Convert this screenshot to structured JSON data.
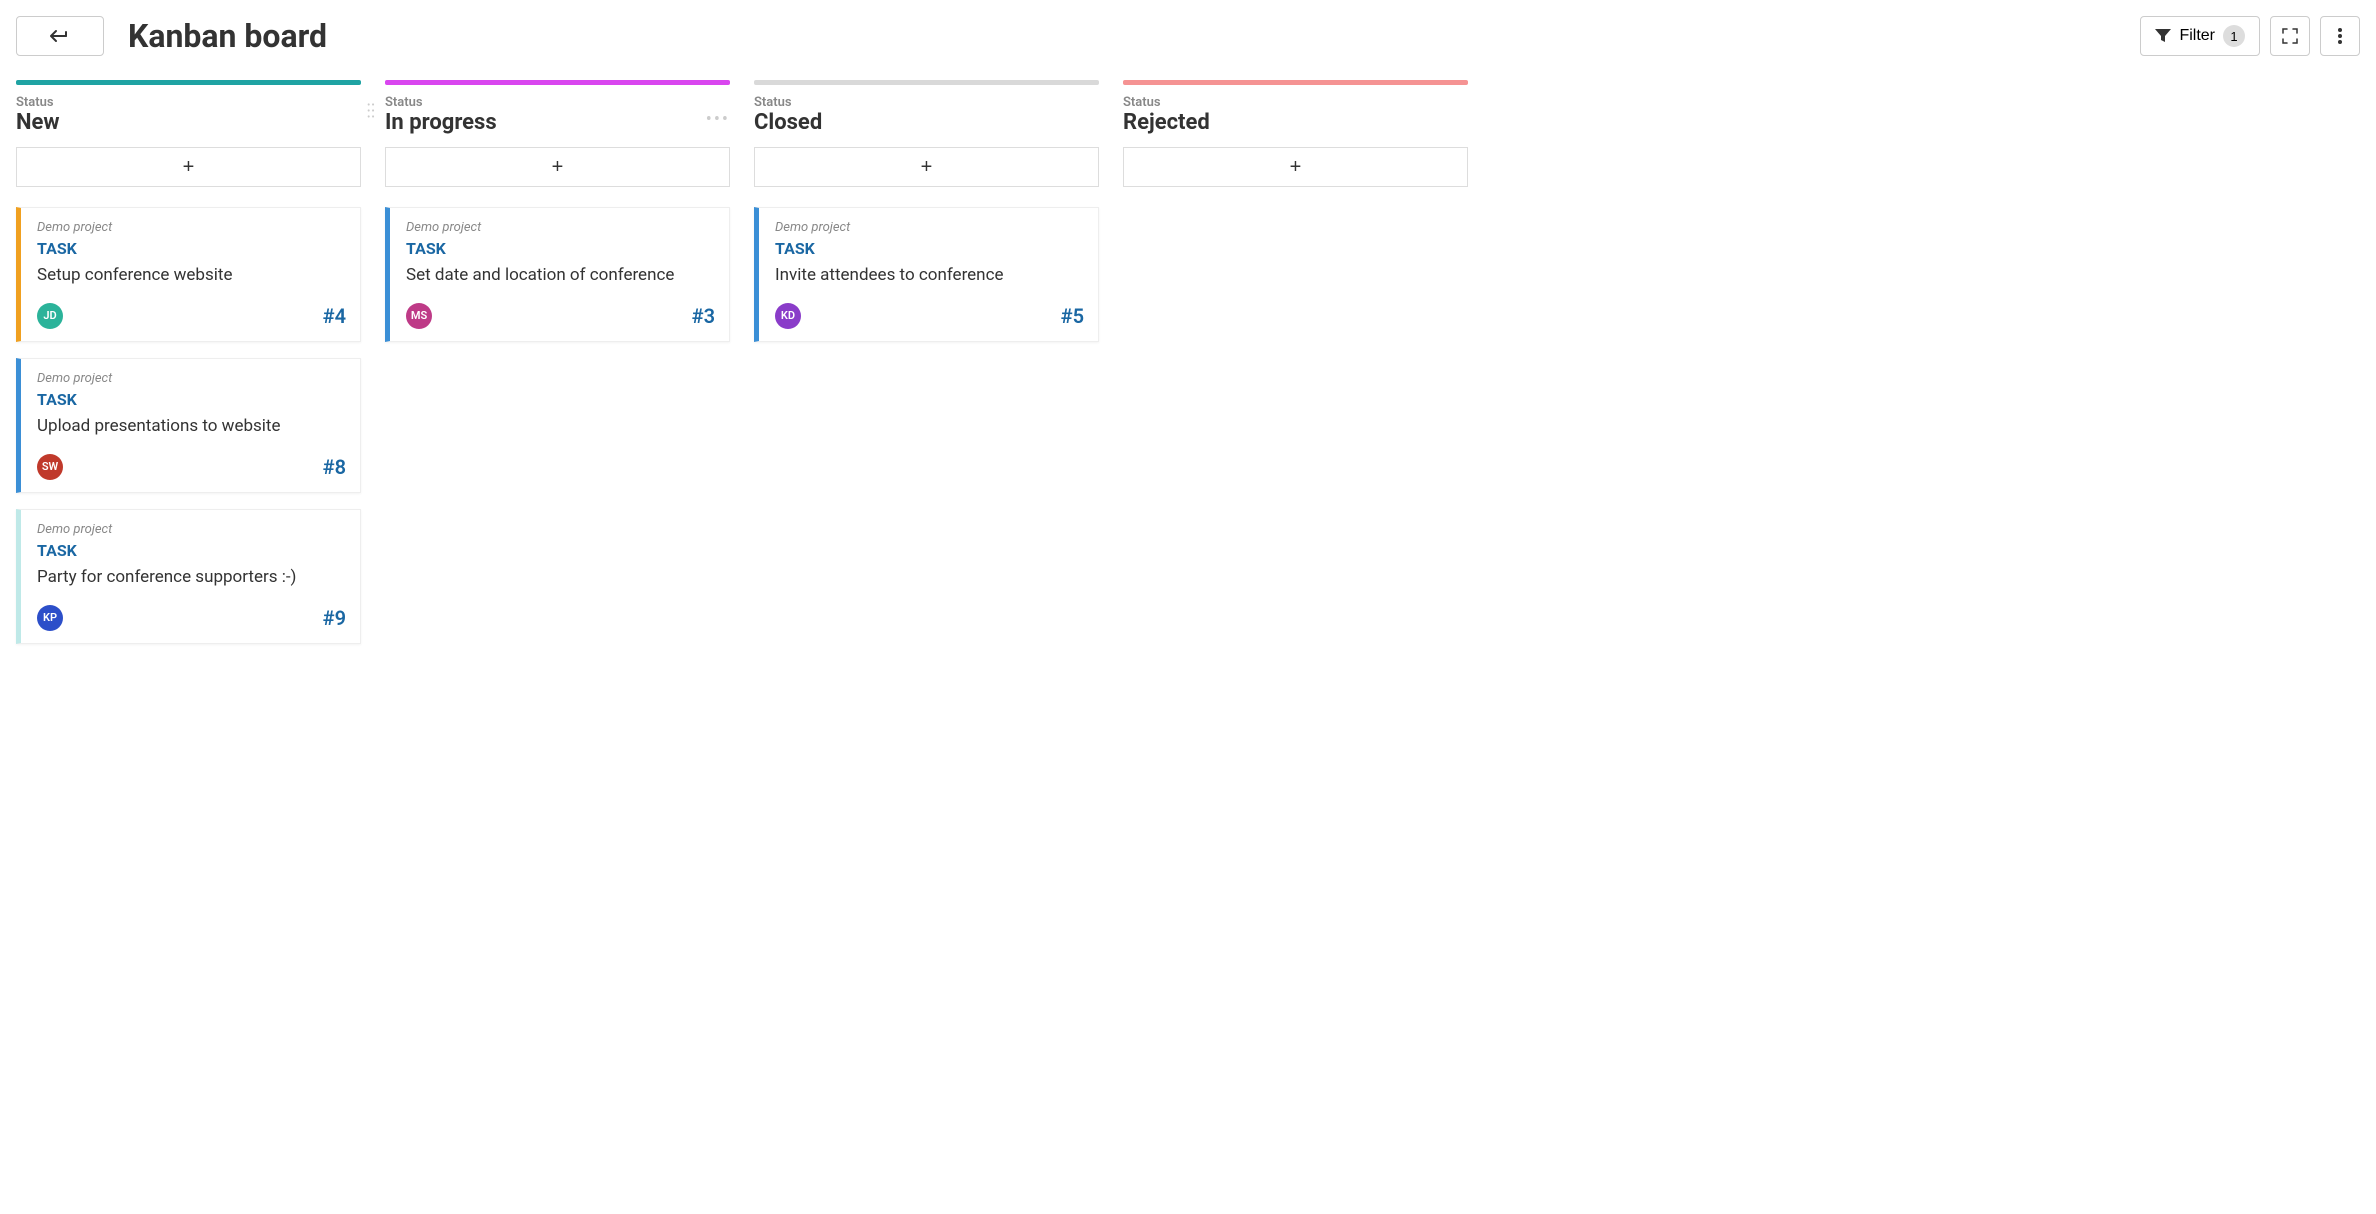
{
  "header": {
    "title": "Kanban board",
    "filter_label": "Filter",
    "filter_count": "1"
  },
  "columns": [
    {
      "label": "Status",
      "title": "New",
      "bar_color": "#1fa3a3",
      "show_handle": false,
      "cards": [
        {
          "project": "Demo project",
          "type": "TASK",
          "title": "Setup conference website",
          "id": "#4",
          "stripe": "#f0a020",
          "avatar_text": "JD",
          "avatar_color": "#2bb39a"
        },
        {
          "project": "Demo project",
          "type": "TASK",
          "title": "Upload presentations to website",
          "id": "#8",
          "stripe": "#3b8fd6",
          "avatar_text": "SW",
          "avatar_color": "#c0392b"
        },
        {
          "project": "Demo project",
          "type": "TASK",
          "title": "Party for conference supporters :-)",
          "id": "#9",
          "stripe": "#bfe9e8",
          "avatar_text": "KP",
          "avatar_color": "#2c4fc9"
        }
      ]
    },
    {
      "label": "Status",
      "title": "In progress",
      "bar_color": "#d946ef",
      "show_handle": true,
      "cards": [
        {
          "project": "Demo project",
          "type": "TASK",
          "title": "Set date and location of conference",
          "id": "#3",
          "stripe": "#3b8fd6",
          "avatar_text": "MS",
          "avatar_color": "#be3a87"
        }
      ]
    },
    {
      "label": "Status",
      "title": "Closed",
      "bar_color": "#d9d9d9",
      "show_handle": false,
      "cards": [
        {
          "project": "Demo project",
          "type": "TASK",
          "title": "Invite attendees to conference",
          "id": "#5",
          "stripe": "#3b8fd6",
          "avatar_text": "KD",
          "avatar_color": "#8a3cc9"
        }
      ]
    },
    {
      "label": "Status",
      "title": "Rejected",
      "bar_color": "#f59393",
      "show_handle": false,
      "cards": []
    }
  ]
}
